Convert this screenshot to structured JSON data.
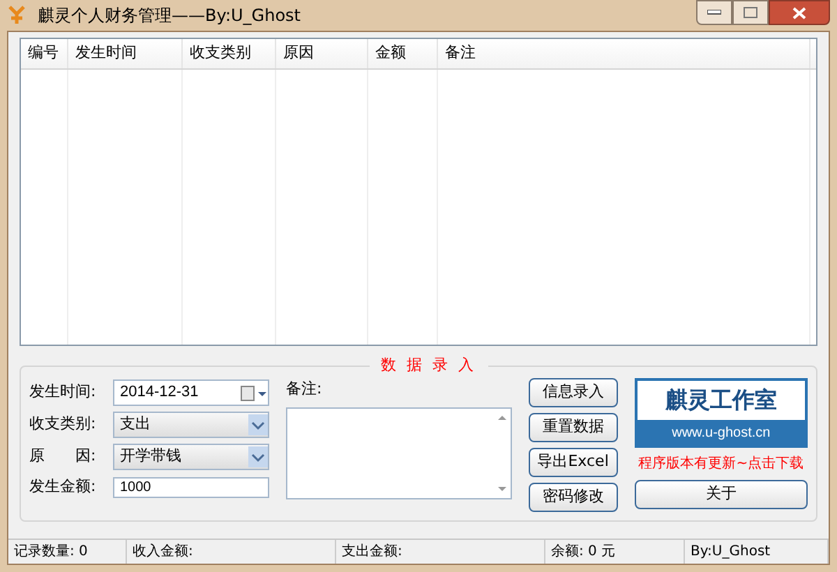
{
  "window": {
    "title": "麒灵个人财务管理——By:U_Ghost"
  },
  "table": {
    "columns": [
      "编号",
      "发生时间",
      "收支类别",
      "原因",
      "金额",
      "备注"
    ]
  },
  "entry": {
    "title": "数 据 录 入",
    "date": {
      "label": "发生时间:",
      "value": "2014-12-31"
    },
    "type": {
      "label": "收支类别:",
      "value": "支出"
    },
    "reason": {
      "label": "原　　因:",
      "value": "开学带钱"
    },
    "amount": {
      "label": "发生金额:",
      "value": "1000"
    },
    "note": {
      "label": "备注:"
    },
    "buttons": [
      "信息录入",
      "重置数据",
      "导出Excel",
      "密码修改"
    ],
    "logo": {
      "title": "麒灵工作室",
      "url": "www.u-ghost.cn"
    },
    "update_link": "程序版本有更新~点击下载",
    "about": "关于"
  },
  "status_bar": [
    "记录数量: 0",
    "收入金额:",
    "支出金额:",
    "余额: 0 元",
    "By:U_Ghost"
  ]
}
